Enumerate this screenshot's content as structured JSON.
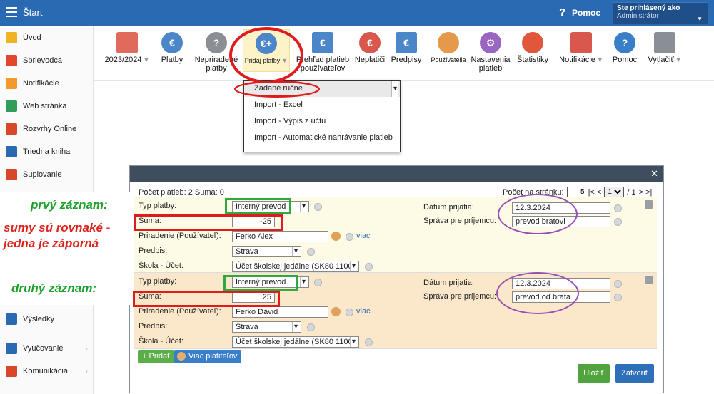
{
  "topbar": {
    "title": "Štart",
    "help_label": "Pomoc",
    "user_heading": "Ste prihlásený ako",
    "user_role": "Administrátor"
  },
  "sidebar": {
    "items": [
      {
        "label": "Úvod",
        "icon": "star-icon",
        "color": "#f0b323"
      },
      {
        "label": "Sprievodca",
        "icon": "wand-icon",
        "color": "#e2462d"
      },
      {
        "label": "Notifikácie",
        "icon": "envelope-icon",
        "color": "#f29b2c"
      },
      {
        "label": "Web stránka",
        "icon": "home-icon",
        "color": "#2f9e5b"
      },
      {
        "label": "Rozvrhy Online",
        "icon": "calendar-icon",
        "color": "#d9472b"
      },
      {
        "label": "Triedna kniha",
        "icon": "book-icon",
        "color": "#2a6ab2"
      },
      {
        "label": "Suplovanie",
        "icon": "person-icon",
        "color": "#d9472b"
      },
      {
        "label": "Výsledky",
        "icon": "bar-chart-icon",
        "color": "#2a6ab2"
      },
      {
        "label": "Vyučovanie",
        "icon": "book-open-icon",
        "color": "#2a6ab2"
      },
      {
        "label": "Komunikácia",
        "icon": "chat-icon",
        "color": "#d9472b"
      }
    ]
  },
  "toolbar": {
    "items": [
      {
        "label": "2023/2024",
        "icon": "calendar-grid-icon",
        "color": "#e06a5c",
        "dropdown": true
      },
      {
        "label": "Platby",
        "icon": "money-bag-euro-icon",
        "color": "#4b86c9",
        "glyph": "€"
      },
      {
        "label": "Nepriradené platby",
        "icon": "money-bag-question-icon",
        "color": "#8a8f96",
        "glyph": "?"
      },
      {
        "label": "Pridaj platby",
        "icon": "money-bag-add-icon",
        "color": "#4b86c9",
        "glyph": "€+",
        "dropdown": true
      },
      {
        "label": "Prehľad platieb používateľov",
        "icon": "ledger-euro-icon",
        "color": "#4b86c9",
        "glyph": "€"
      },
      {
        "label": "Neplatiči",
        "icon": "money-bag-clock-icon",
        "color": "#d9574c",
        "glyph": "€"
      },
      {
        "label": "Predpisy",
        "icon": "document-euro-icon",
        "color": "#4b86c9",
        "glyph": "€"
      },
      {
        "label": "Používatelia",
        "icon": "user-icon",
        "color": "#e59a4b",
        "glyph": ""
      },
      {
        "label": "Nastavenia platieb",
        "icon": "gear-icon",
        "color": "#9b66c2",
        "glyph": "⚙"
      },
      {
        "label": "Štatistiky",
        "icon": "pie-chart-icon",
        "color": "#e0573c",
        "glyph": ""
      },
      {
        "label": "Notifikácie",
        "icon": "phone-icon",
        "color": "#d9574c",
        "glyph": "",
        "dropdown": true
      },
      {
        "label": "Pomoc",
        "icon": "help-icon",
        "color": "#3a7dc9",
        "glyph": "?"
      },
      {
        "label": "Vytlačiť",
        "icon": "printer-icon",
        "color": "#8a8f96",
        "glyph": "",
        "dropdown": true
      }
    ]
  },
  "dropdown": {
    "items": [
      "Zadané ručne",
      "Import - Excel",
      "Import - Výpis z účtu",
      "Import - Automatické nahrávanie platieb"
    ]
  },
  "dialog": {
    "counts": "Počet platieb: 2   Suma: 0",
    "per_page_label": "Počet na stránku:",
    "per_page": "5",
    "page_nav_prev": "|< <",
    "page": "1",
    "page_total": "/ 1",
    "page_nav_next": "> >|",
    "records": [
      {
        "labels": {
          "type": "Typ platby:",
          "sum": "Suma:",
          "assign": "Priradenie (Používateľ):",
          "prescription": "Predpis:",
          "school": "Škola - Účet:",
          "date": "Dátum prijatia:",
          "message": "Správa pre príjemcu:"
        },
        "type": "Interný prevod",
        "sum": "-25",
        "assign": "Ferko Alex",
        "prescription": "Strava",
        "school": "Účet školskej jedálne (SK80 1100",
        "date": "12.3.2024",
        "message": "prevod bratovi",
        "viac": "viac"
      },
      {
        "labels": {
          "type": "Typ platby:",
          "sum": "Suma:",
          "assign": "Priradenie (Používateľ):",
          "prescription": "Predpis:",
          "school": "Škola - Účet:",
          "date": "Dátum prijatia:",
          "message": "Správa pre príjemcu:"
        },
        "type": "Interný prevod",
        "sum": "25",
        "assign": "Ferko Dávid",
        "prescription": "Strava",
        "school": "Účet školskej jedálne (SK80 1100",
        "date": "12.3.2024",
        "message": "prevod od brata",
        "viac": "viac"
      }
    ],
    "add_button": "+ Pridať",
    "more_payers_button": "Viac platiteľov",
    "save_button": "Uložiť",
    "close_button": "Zatvoriť"
  },
  "annotations": {
    "first": "prvý  záznam:",
    "note_line1": "sumy sú rovnaké -",
    "note_line2": "jedna je záporná",
    "second": "druhý  záznam:"
  }
}
